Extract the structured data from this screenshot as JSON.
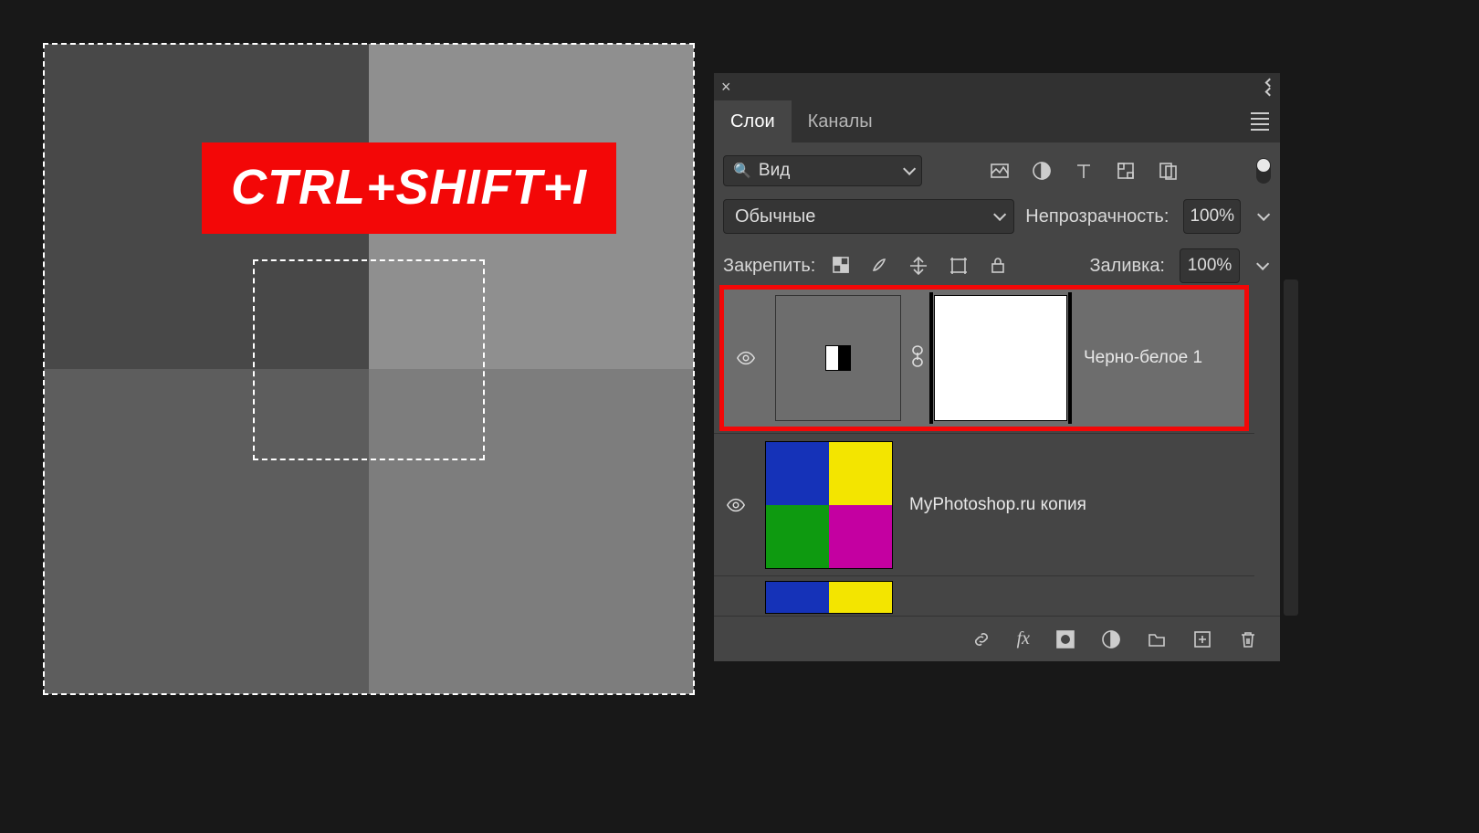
{
  "shortcut_text": "CTRL+SHIFT+I",
  "panel": {
    "tabs": {
      "layers": "Слои",
      "channels": "Каналы"
    },
    "kind_label": "Вид",
    "blend_mode": "Обычные",
    "opacity_label": "Непрозрачность:",
    "opacity_value": "100%",
    "lock_label": "Закрепить:",
    "fill_label": "Заливка:",
    "fill_value": "100%",
    "layers": [
      {
        "name": "Черно-белое 1"
      },
      {
        "name": "MyPhotoshop.ru копия"
      }
    ]
  }
}
